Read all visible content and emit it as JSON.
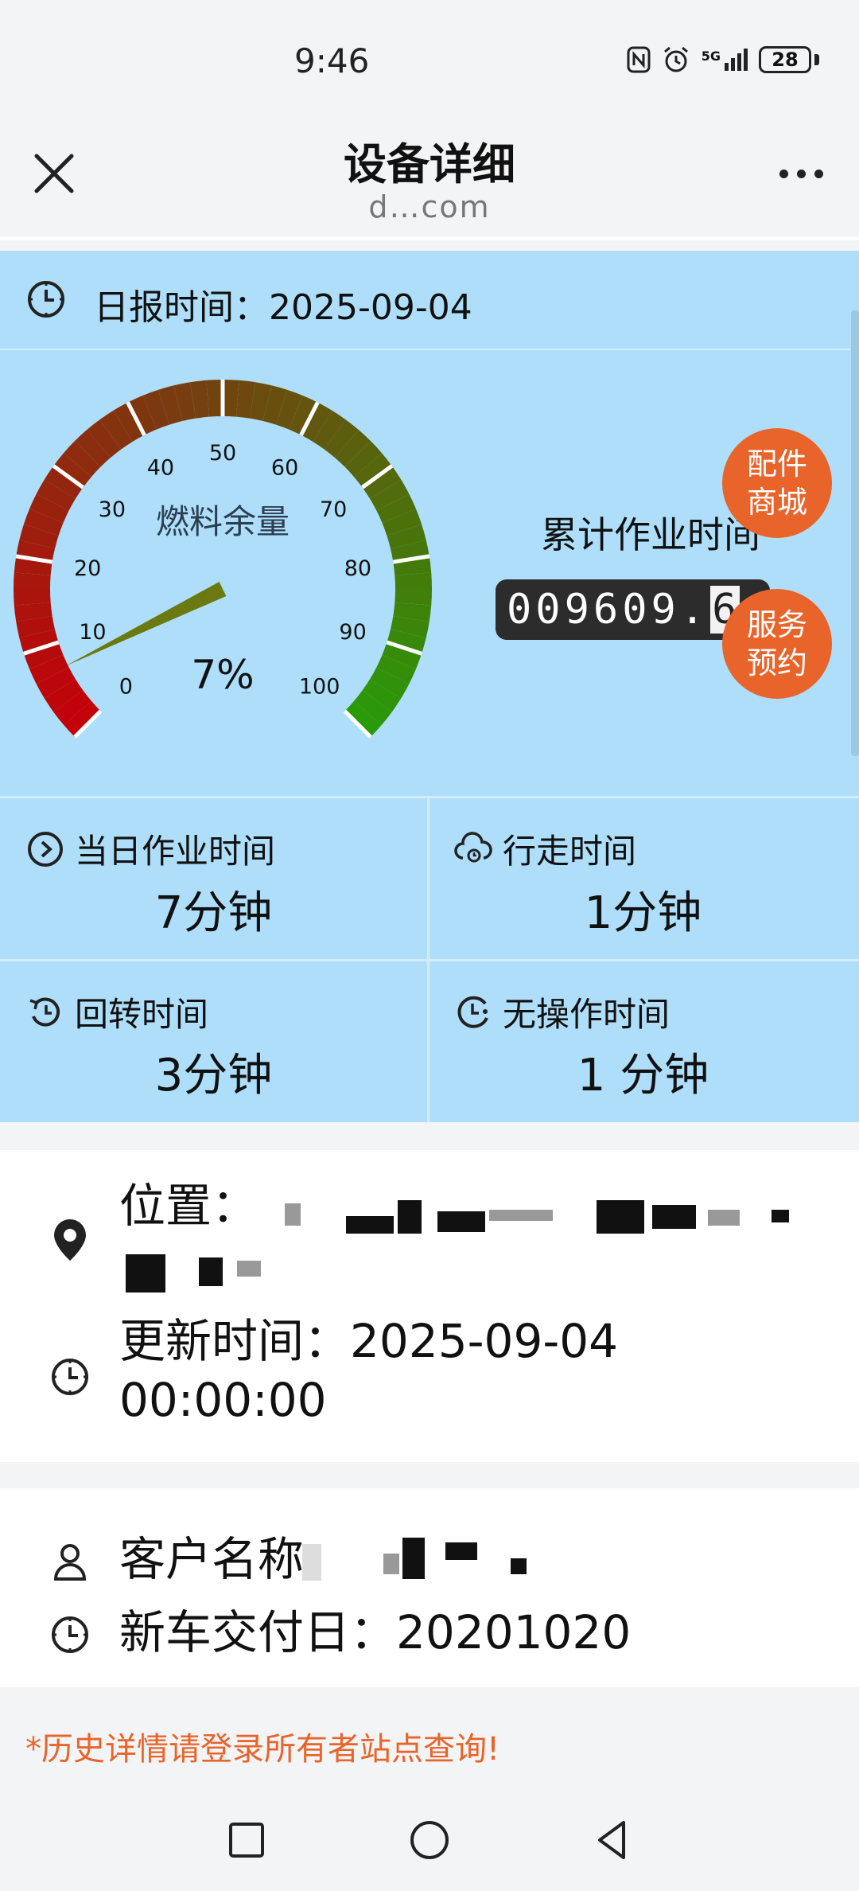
{
  "status_bar": {
    "time": "9:46",
    "network": "5G",
    "battery": "28"
  },
  "title_bar": {
    "title": "设备详细",
    "domain": "d…com"
  },
  "report": {
    "label": "日报时间：",
    "date": "2025-09-04"
  },
  "gauge": {
    "label": "燃料余量",
    "value_percent": 7,
    "value_text": "7%",
    "ticks": [
      "0",
      "10",
      "20",
      "30",
      "40",
      "50",
      "60",
      "70",
      "80",
      "90",
      "100"
    ]
  },
  "counter": {
    "label": "累计作业时间",
    "digits": "009609.",
    "decimal": "6",
    "decimal2": "6"
  },
  "bubbles": {
    "parts": "配件\n商城",
    "parts_line1": "配件",
    "parts_line2": "商城",
    "service_line1": "服务",
    "service_line2": "预约"
  },
  "stats": [
    {
      "label": "当日作业时间",
      "value": "7分钟",
      "icon": "play-circle-icon"
    },
    {
      "label": "行走时间",
      "value": "1分钟",
      "icon": "cloud-clock-icon"
    },
    {
      "label": "回转时间",
      "value": "3分钟",
      "icon": "rotate-clock-icon"
    },
    {
      "label": "无操作时间",
      "value": "1 分钟",
      "icon": "idle-clock-icon"
    }
  ],
  "location": {
    "label": "位置：",
    "update_label": "更新时间：",
    "update_date": "2025-09-04",
    "update_time": "00:00:00"
  },
  "customer": {
    "name_label": "客户名称",
    "delivery_label": "新车交付日：",
    "delivery_date": "20201020"
  },
  "notice": "*历史详情请登录所有者站点查询!",
  "colors": {
    "accent": "#e8642a",
    "panel": "#aedefa"
  }
}
